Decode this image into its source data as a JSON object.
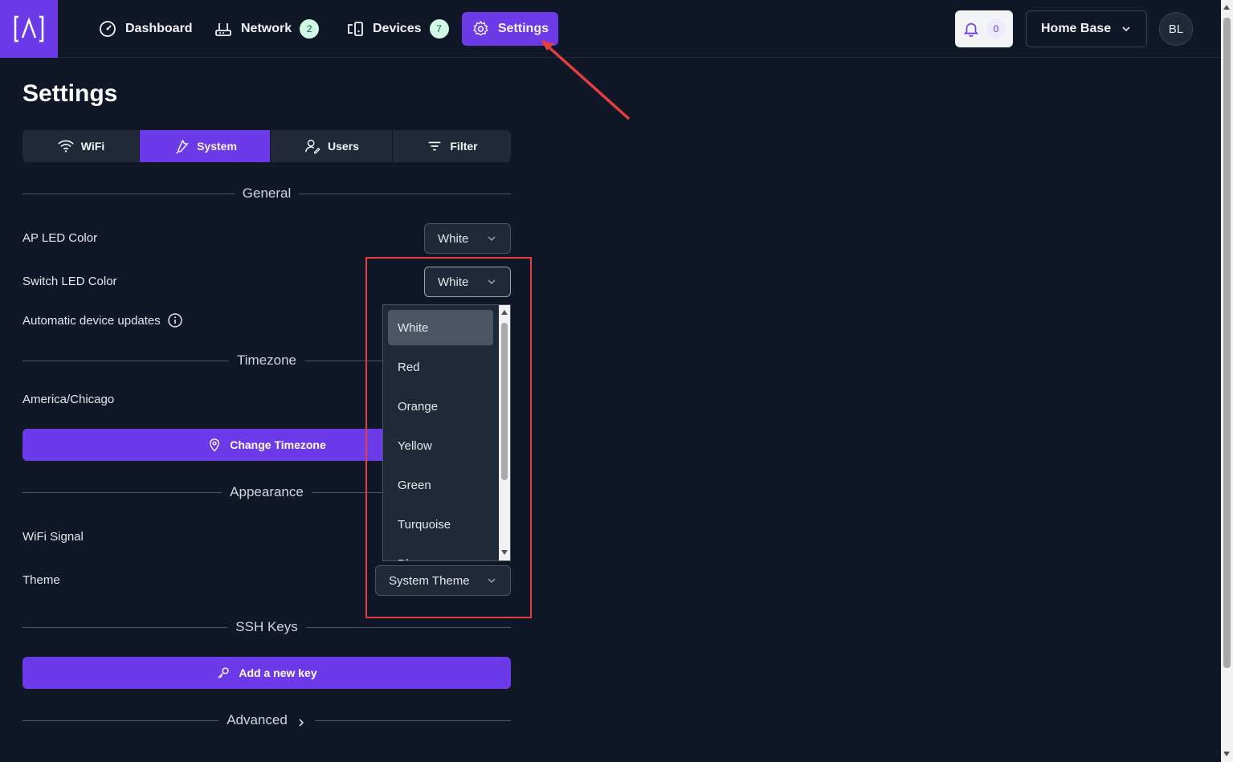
{
  "nav": {
    "items": [
      {
        "label": "Dashboard",
        "icon": "gauge-icon"
      },
      {
        "label": "Network",
        "icon": "router-icon",
        "badge": "2"
      },
      {
        "label": "Devices",
        "icon": "devices-icon",
        "badge": "7"
      },
      {
        "label": "Settings",
        "icon": "gear-icon",
        "active": true
      }
    ],
    "notifications_count": "0",
    "site_name": "Home Base",
    "avatar_initials": "BL"
  },
  "page": {
    "title": "Settings",
    "tabs": [
      {
        "label": "WiFi",
        "icon": "wifi-icon"
      },
      {
        "label": "System",
        "icon": "wrench-icon",
        "active": true
      },
      {
        "label": "Users",
        "icon": "users-icon"
      },
      {
        "label": "Filter",
        "icon": "filter-icon"
      }
    ]
  },
  "general": {
    "heading": "General",
    "ap_led_label": "AP LED Color",
    "ap_led_value": "White",
    "switch_led_label": "Switch LED Color",
    "switch_led_value": "White",
    "auto_updates_label": "Automatic device updates"
  },
  "timezone": {
    "heading": "Timezone",
    "value": "America/Chicago",
    "change_button": "Change Timezone"
  },
  "appearance": {
    "heading": "Appearance",
    "wifi_signal_label": "WiFi Signal",
    "theme_label": "Theme",
    "theme_value": "System Theme"
  },
  "ssh": {
    "heading": "SSH Keys",
    "add_button": "Add a new key"
  },
  "advanced": {
    "heading": "Advanced"
  },
  "dropdown": {
    "options": [
      "White",
      "Red",
      "Orange",
      "Yellow",
      "Green",
      "Turquoise",
      "Blue"
    ],
    "selected": "White"
  },
  "colors": {
    "accent": "#6d3ae8",
    "background": "#101828",
    "annotation": "#e53e3e"
  }
}
